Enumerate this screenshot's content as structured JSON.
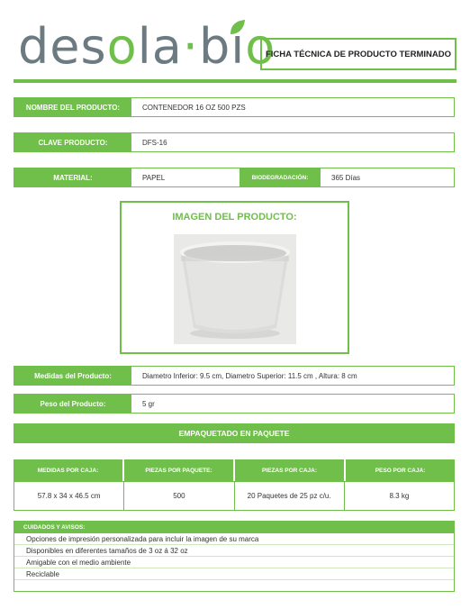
{
  "header": {
    "logo": {
      "part1": "des",
      "part2": "o",
      "part3": "la",
      "dot": "·",
      "part4": "bi",
      "part5": "o"
    },
    "sheet_title": "FICHA TÉCNICA DE PRODUCTO TERMINADO"
  },
  "product": {
    "name_label": "NOMBRE DEL PRODUCTO:",
    "name_value": "CONTENEDOR 16 OZ 500 PZS",
    "key_label": "CLAVE PRODUCTO:",
    "key_value": "DFS-16",
    "material_label": "MATERIAL:",
    "material_value": "PAPEL",
    "biodeg_label": "BIODEGRADACIÓN:",
    "biodeg_value": "365 Días"
  },
  "image_section": {
    "title": "IMAGEN DEL PRODUCTO:"
  },
  "specs": {
    "measures_label": "Medidas del Producto:",
    "measures_value": "Diametro Inferior: 9.5 cm, Diametro Superior: 11.5 cm , Altura: 8 cm",
    "weight_label": "Peso del Producto:",
    "weight_value": "5 gr"
  },
  "packaging": {
    "band_title": "EMPAQUETADO EN PAQUETE",
    "headers": [
      "MEDIDAS POR CAJA:",
      "PIEZAS POR PAQUETE:",
      "PIEZAS POR CAJA:",
      "PESO POR CAJA:"
    ],
    "values": [
      "57.8 x 34 x 46.5 cm",
      "500",
      "20 Paquetes de 25 pz c/u.",
      "8.3 kg"
    ]
  },
  "care": {
    "title": "CUIDADOS Y AVISOS:",
    "items": [
      "Opciones de impresión personalizada para incluir la imagen de su marca",
      "Disponibles en diferentes tamaños de 3 oz á 32 oz",
      "Amigable con el medio ambiente",
      "Reciclable"
    ]
  },
  "colors": {
    "brand_green": "#6fbf4a",
    "brand_gray": "#6c7a82"
  }
}
